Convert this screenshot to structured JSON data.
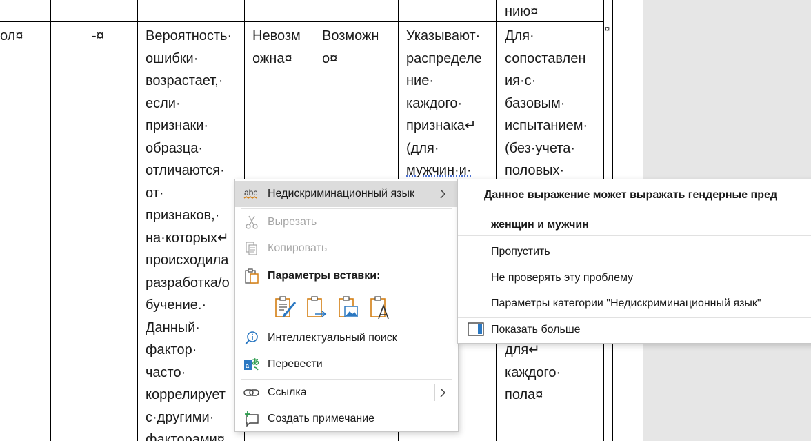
{
  "document": {
    "top_row_tail": "нию¤",
    "row_marker": "¤",
    "col1": "ол¤",
    "col2": "-¤",
    "col3": [
      "Вероятность·",
      "ошибки·",
      "возрастает,·",
      "если·",
      "признаки·",
      "образца·",
      "отличаются·",
      "от·",
      "признаков,·",
      "на·которых↵",
      "происходила",
      "разработка/о",
      "бучение.·",
      "Данный·",
      "фактор·",
      "часто·",
      "коррелирует",
      "с·другими·",
      "факторами¤"
    ],
    "col4": [
      "Невозм",
      "ожна¤"
    ],
    "col5": [
      "Возможн",
      "о¤"
    ],
    "col6": [
      "Указывают·",
      "распределе",
      "ние·",
      "каждого·",
      "признака↵",
      "(для·",
      "мужчин·и·"
    ],
    "col7_top": [
      "Для·",
      "сопоставлен",
      "ия·с·",
      "базовым·",
      "испытанием·",
      "(без·учета·",
      "половых·"
    ],
    "col7_bottom": [
      "для↵",
      "каждого·",
      "пола¤"
    ]
  },
  "context_menu": {
    "items": [
      {
        "label": "Недискриминационный язык",
        "icon": "abc-spellcheck-icon",
        "highlighted": true,
        "submenu": true
      },
      {
        "label": "Вырезать",
        "icon": "scissors-icon",
        "disabled": true
      },
      {
        "label": "Копировать",
        "icon": "copy-icon",
        "disabled": true
      },
      {
        "label": "Параметры вставки:",
        "icon": "paste-icon",
        "bold": true
      },
      {
        "label": "Интеллектуальный поиск",
        "icon": "smart-lookup-icon"
      },
      {
        "label": "Перевести",
        "icon": "translate-icon"
      },
      {
        "label": "Ссылка",
        "icon": "link-icon",
        "submenu": true
      },
      {
        "label": "Создать примечание",
        "icon": "new-comment-icon"
      }
    ],
    "paste_options": [
      "keep-source-formatting-icon",
      "merge-formatting-icon",
      "picture-icon",
      "keep-text-only-icon"
    ]
  },
  "submenu": {
    "heading_line1": "Данное выражение может выражать гендерные пред",
    "heading_line2": "женщин и мужчин",
    "items": [
      {
        "label": "Пропустить"
      },
      {
        "label": "Не проверять эту проблему"
      },
      {
        "label": "Параметры категории \"Недискриминационный язык\""
      },
      {
        "label": "Показать больше",
        "icon": "show-more-panel-icon"
      }
    ]
  },
  "colors": {
    "accent_orange": "#d47f13",
    "accent_blue": "#2b78c2",
    "highlight": "#dcdcdc",
    "spelling_underline": "#4a6fd0"
  }
}
